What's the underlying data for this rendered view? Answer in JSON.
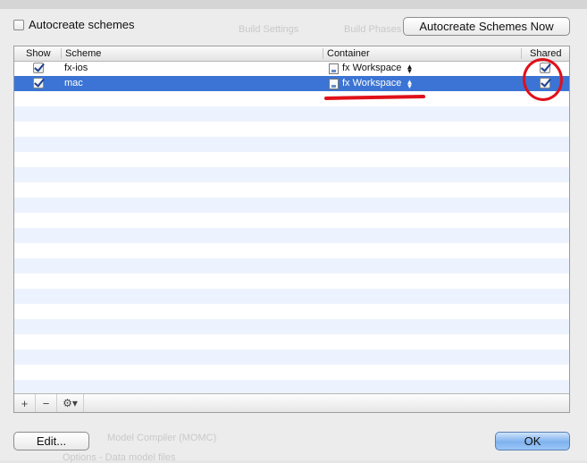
{
  "toolbar": {
    "autocreate_label": "Autocreate schemes",
    "autocreate_checked": false,
    "autocreate_now_label": "Autocreate Schemes Now"
  },
  "background": {
    "build_settings": "Build Settings",
    "build_phases": "Build Phases",
    "model_compiler": "Model Compiler (MOMC)",
    "open_model": "Options - Data model files"
  },
  "table": {
    "columns": {
      "show": "Show",
      "scheme": "Scheme",
      "container": "Container",
      "shared": "Shared"
    },
    "rows": [
      {
        "show": true,
        "scheme": "fx-ios",
        "container": "fx Workspace",
        "shared": true,
        "selected": false
      },
      {
        "show": true,
        "scheme": "mac",
        "container": "fx Workspace",
        "shared": true,
        "selected": true
      }
    ],
    "empty_row_count": 20
  },
  "bottom_bar": {
    "add_icon": "plus-icon",
    "remove_icon": "minus-icon",
    "action_icon": "gear-icon"
  },
  "buttons": {
    "edit": "Edit...",
    "ok": "OK"
  },
  "colors": {
    "selection": "#3b74d4",
    "stripe": "#edf3fe",
    "annotation": "#e0101a"
  }
}
